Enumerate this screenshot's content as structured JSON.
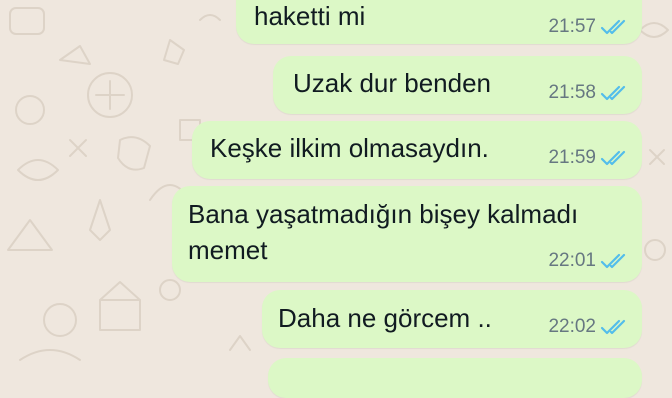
{
  "chat": {
    "messages": [
      {
        "text": "haketti mi",
        "time": "21:57",
        "status": "read",
        "direction": "outgoing"
      },
      {
        "text": "Uzak dur benden",
        "time": "21:58",
        "status": "read",
        "direction": "outgoing"
      },
      {
        "text": "Keşke ilkim olmasaydın.",
        "time": "21:59",
        "status": "read",
        "direction": "outgoing"
      },
      {
        "text_line1": "Bana yaşatmadığın bişey kalmadı",
        "text_line2": "memet",
        "time": "22:01",
        "status": "read",
        "direction": "outgoing"
      },
      {
        "text": "Daha ne görcem ..",
        "time": "22:02",
        "status": "read",
        "direction": "outgoing"
      }
    ]
  },
  "colors": {
    "chat_background": "#efe7de",
    "outgoing_bubble": "#dcf8c6",
    "read_tick": "#53bdeb",
    "meta_text": "#667781"
  },
  "icons": [
    "double-check-read-icon"
  ]
}
